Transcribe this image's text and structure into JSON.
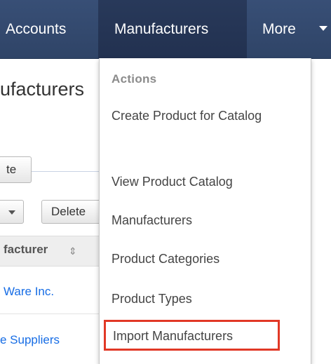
{
  "navbar": {
    "tabs": [
      {
        "label": "Accounts"
      },
      {
        "label": "Manufacturers"
      },
      {
        "label": "More"
      }
    ],
    "active_tab": "Manufacturers"
  },
  "page": {
    "heading_fragment": "ufacturers",
    "create_button_fragment": "te",
    "delete_button_fragment": "Delete",
    "column_header_fragment": "facturer",
    "rows": [
      {
        "name_fragment": "Ware Inc."
      },
      {
        "name_fragment": "e Suppliers"
      }
    ]
  },
  "dropdown": {
    "header": "Actions",
    "items": [
      {
        "label": "Create Product for Catalog"
      },
      {
        "label": "View Product Catalog"
      },
      {
        "label": "Manufacturers"
      },
      {
        "label": "Product Categories"
      },
      {
        "label": "Product Types"
      },
      {
        "label": "Import Manufacturers",
        "highlighted": true
      }
    ]
  },
  "colors": {
    "navbar_bg": "#34496e",
    "navbar_active_bg": "#25355a",
    "link_blue": "#176de5",
    "highlight_border": "#e13826"
  },
  "icons": {
    "more_caret": "chevron-down-icon",
    "sort": "sort-icon"
  }
}
